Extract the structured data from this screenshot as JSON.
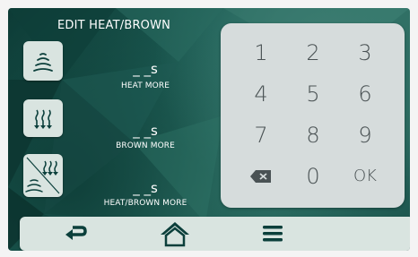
{
  "header": {
    "title": "EDIT HEAT/BROWN"
  },
  "modes": [
    {
      "icon": "heat-waves-icon",
      "value": "_ _s",
      "label": "HEAT MORE"
    },
    {
      "icon": "brown-arrows-icon",
      "value": "_ _s",
      "label": "BROWN MORE"
    },
    {
      "icon": "heat-brown-combo-icon",
      "value": "_ _s",
      "label": "HEAT/BROWN MORE"
    }
  ],
  "keypad": {
    "keys": [
      "1",
      "2",
      "3",
      "4",
      "5",
      "6",
      "7",
      "8",
      "9",
      "",
      "0",
      "OK"
    ],
    "backspace_icon": "backspace-icon"
  },
  "navbar": {
    "icons": [
      "back-arrow-icon",
      "home-icon",
      "menu-icon"
    ]
  },
  "colors": {
    "panel": "#d9e4e0",
    "keypad": "#d6dcdc",
    "background": "#1e5f56",
    "icon": "#0b3f3b"
  }
}
